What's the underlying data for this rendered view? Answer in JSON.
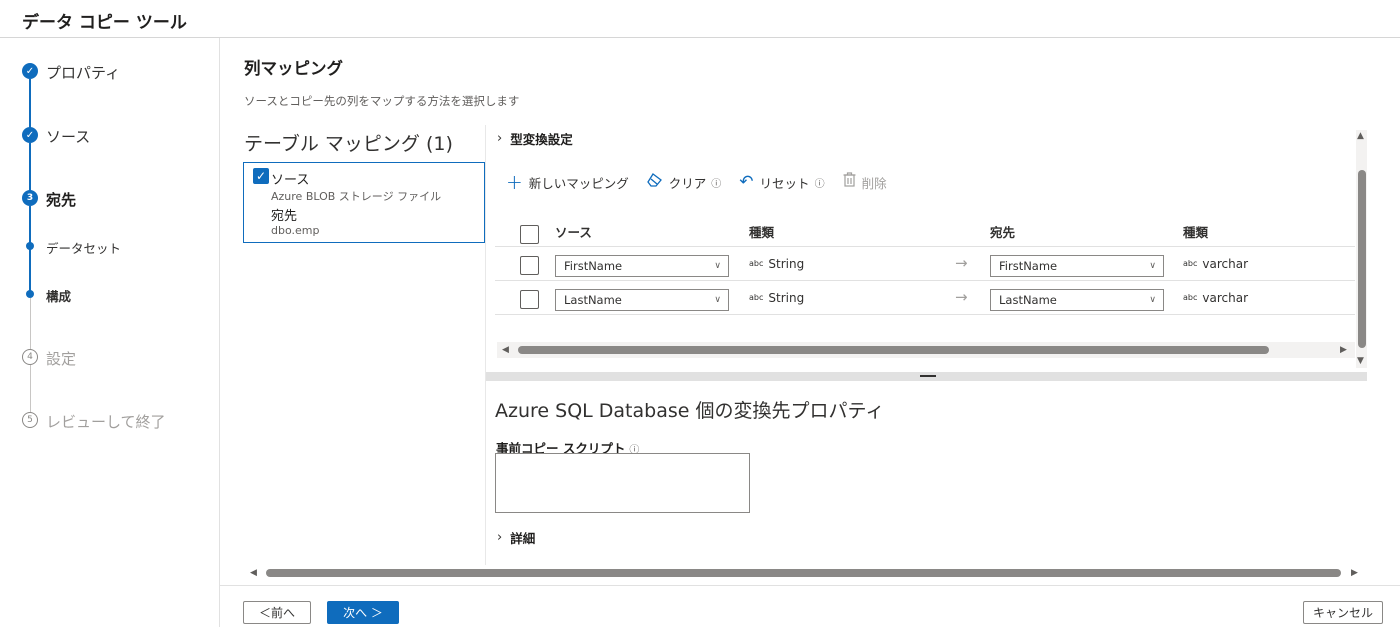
{
  "app": {
    "title": "データ コピー ツール"
  },
  "steps": [
    {
      "label": "プロパティ",
      "state": "done",
      "marker": "✓"
    },
    {
      "label": "ソース",
      "state": "done",
      "marker": "✓"
    },
    {
      "label": "宛先",
      "state": "active",
      "marker": "3"
    },
    {
      "label": "データセット",
      "state": "sub-done"
    },
    {
      "label": "構成",
      "state": "sub-active"
    },
    {
      "label": "設定",
      "state": "pending",
      "marker": "4"
    },
    {
      "label": "レビューして終了",
      "state": "pending",
      "marker": "5"
    }
  ],
  "section": {
    "title": "列マッピング",
    "description": "ソースとコピー先の列をマップする方法を選択します"
  },
  "table_mapping": {
    "title": "テーブル マッピング (1)",
    "card": {
      "source_label": "ソース",
      "source_value": "Azure BLOB ストレージ ファイル",
      "dest_label": "宛先",
      "dest_value": "dbo.emp"
    }
  },
  "type_conversion": {
    "label": "型変換設定"
  },
  "toolbar": {
    "new_mapping": "新しいマッピング",
    "clear": "クリア",
    "reset": "リセット",
    "delete": "削除"
  },
  "columns": {
    "source": "ソース",
    "source_type": "種類",
    "destination": "宛先",
    "dest_type": "種類"
  },
  "abc_glyph": "abc",
  "rows": [
    {
      "source": "FirstName",
      "source_type": "String",
      "destination": "FirstName",
      "dest_type": "varchar"
    },
    {
      "source": "LastName",
      "source_type": "String",
      "destination": "LastName",
      "dest_type": "varchar"
    }
  ],
  "dest_properties": {
    "title": "Azure SQL Database 個の変換先プロパティ",
    "pre_copy_script_label": "事前コピー スクリプト",
    "pre_copy_script_value": ""
  },
  "details": {
    "label": "詳細"
  },
  "footer": {
    "prev": "＜前へ",
    "next": "次へ ＞",
    "cancel": "キャンセル"
  },
  "colors": {
    "accent": "#0f6cbd",
    "border": "#8a8886",
    "disabled": "#a19f9d"
  }
}
